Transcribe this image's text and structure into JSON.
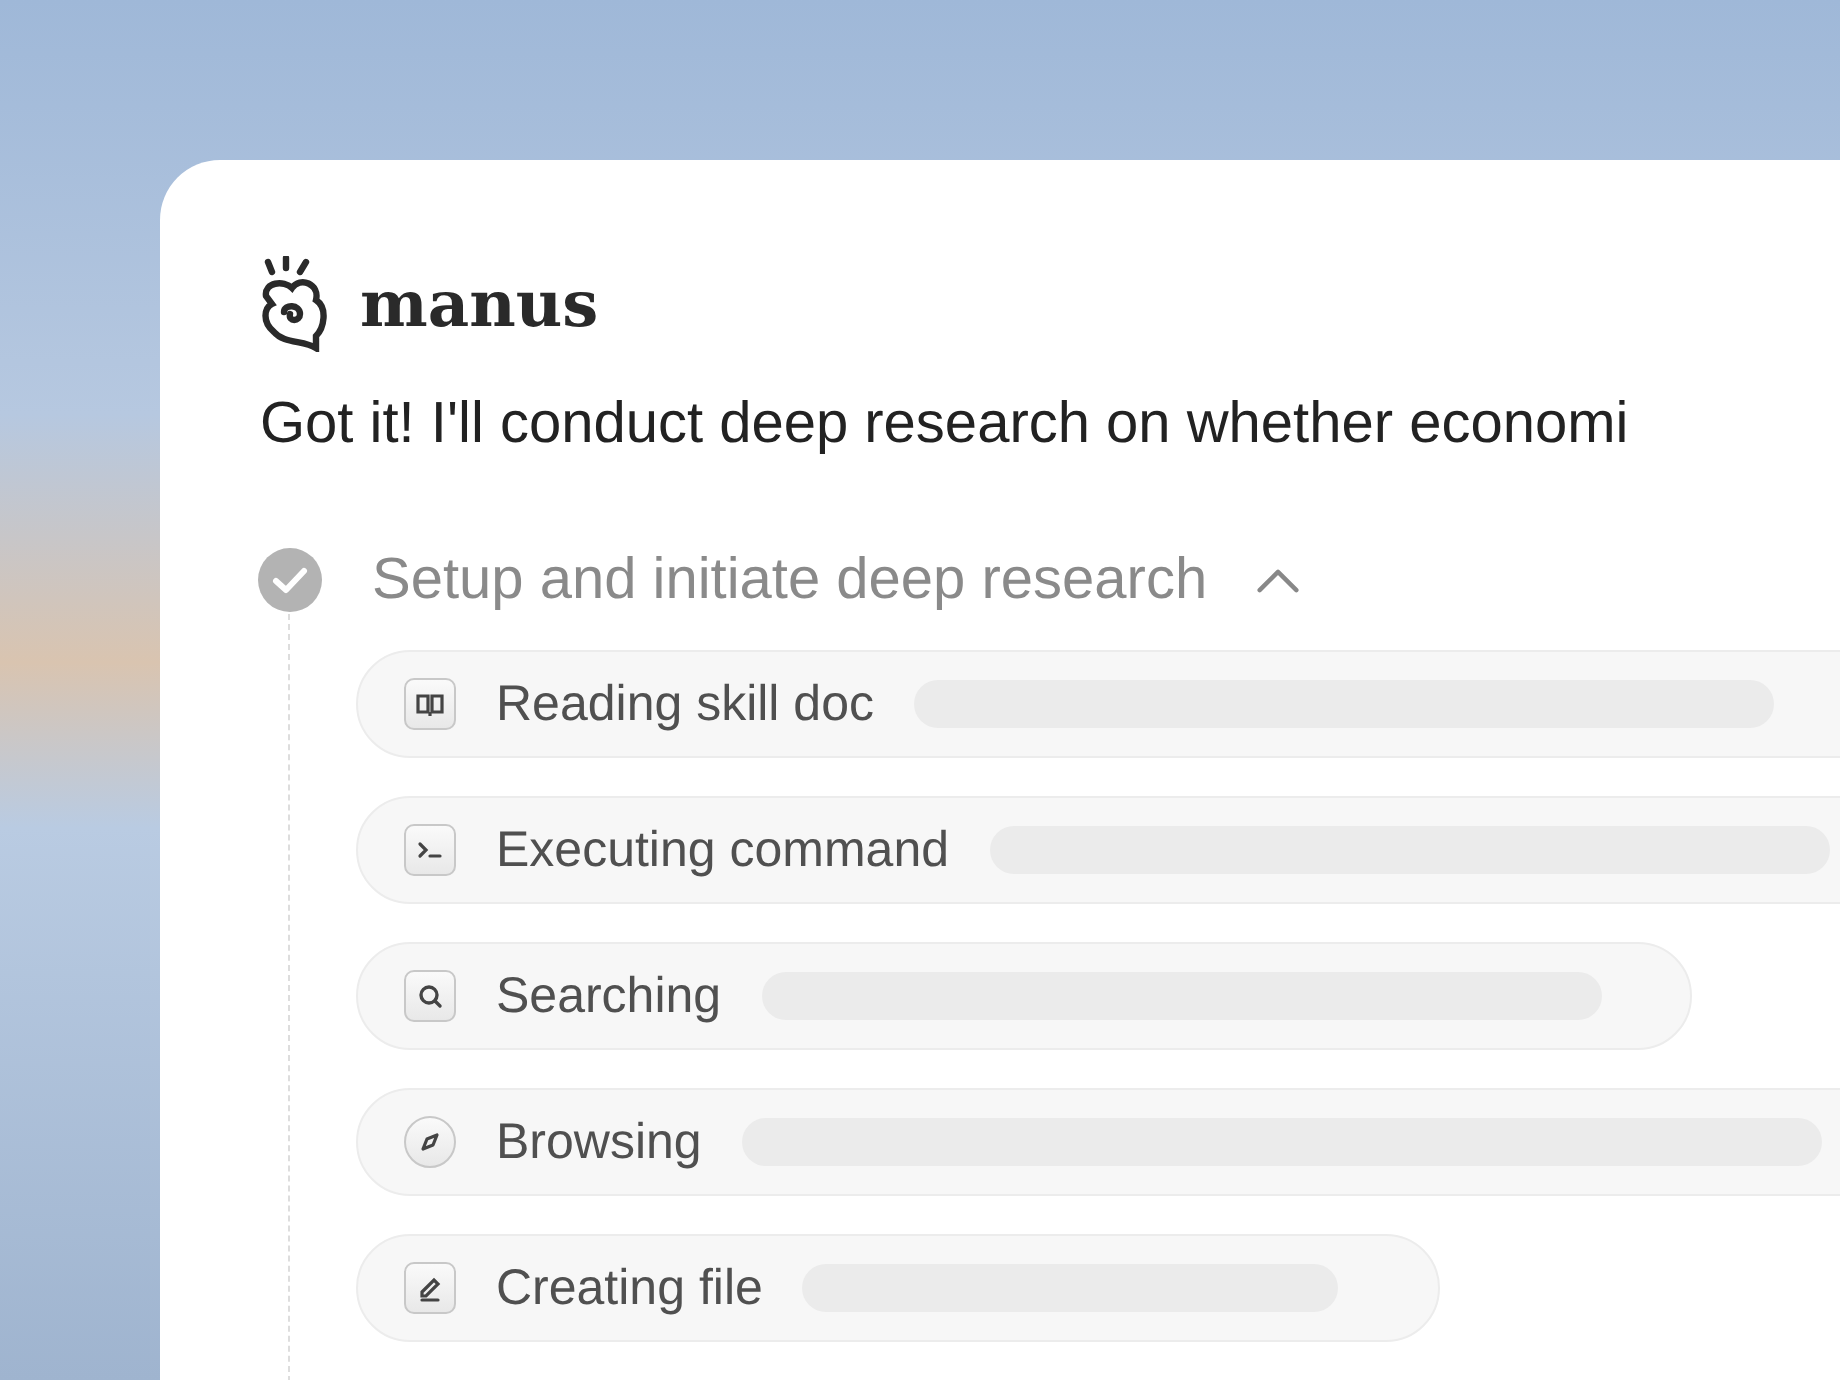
{
  "app": {
    "name": "manus"
  },
  "message": "Got it! I'll conduct deep research on whether economi",
  "task": {
    "title": "Setup and initiate deep research",
    "completed": true,
    "expanded": true,
    "steps": [
      {
        "kind": "read",
        "label": "Reading skill doc"
      },
      {
        "kind": "terminal",
        "label": "Executing command"
      },
      {
        "kind": "search",
        "label": "Searching"
      },
      {
        "kind": "browse",
        "label": "Browsing"
      },
      {
        "kind": "edit",
        "label": "Creating file"
      }
    ]
  }
}
